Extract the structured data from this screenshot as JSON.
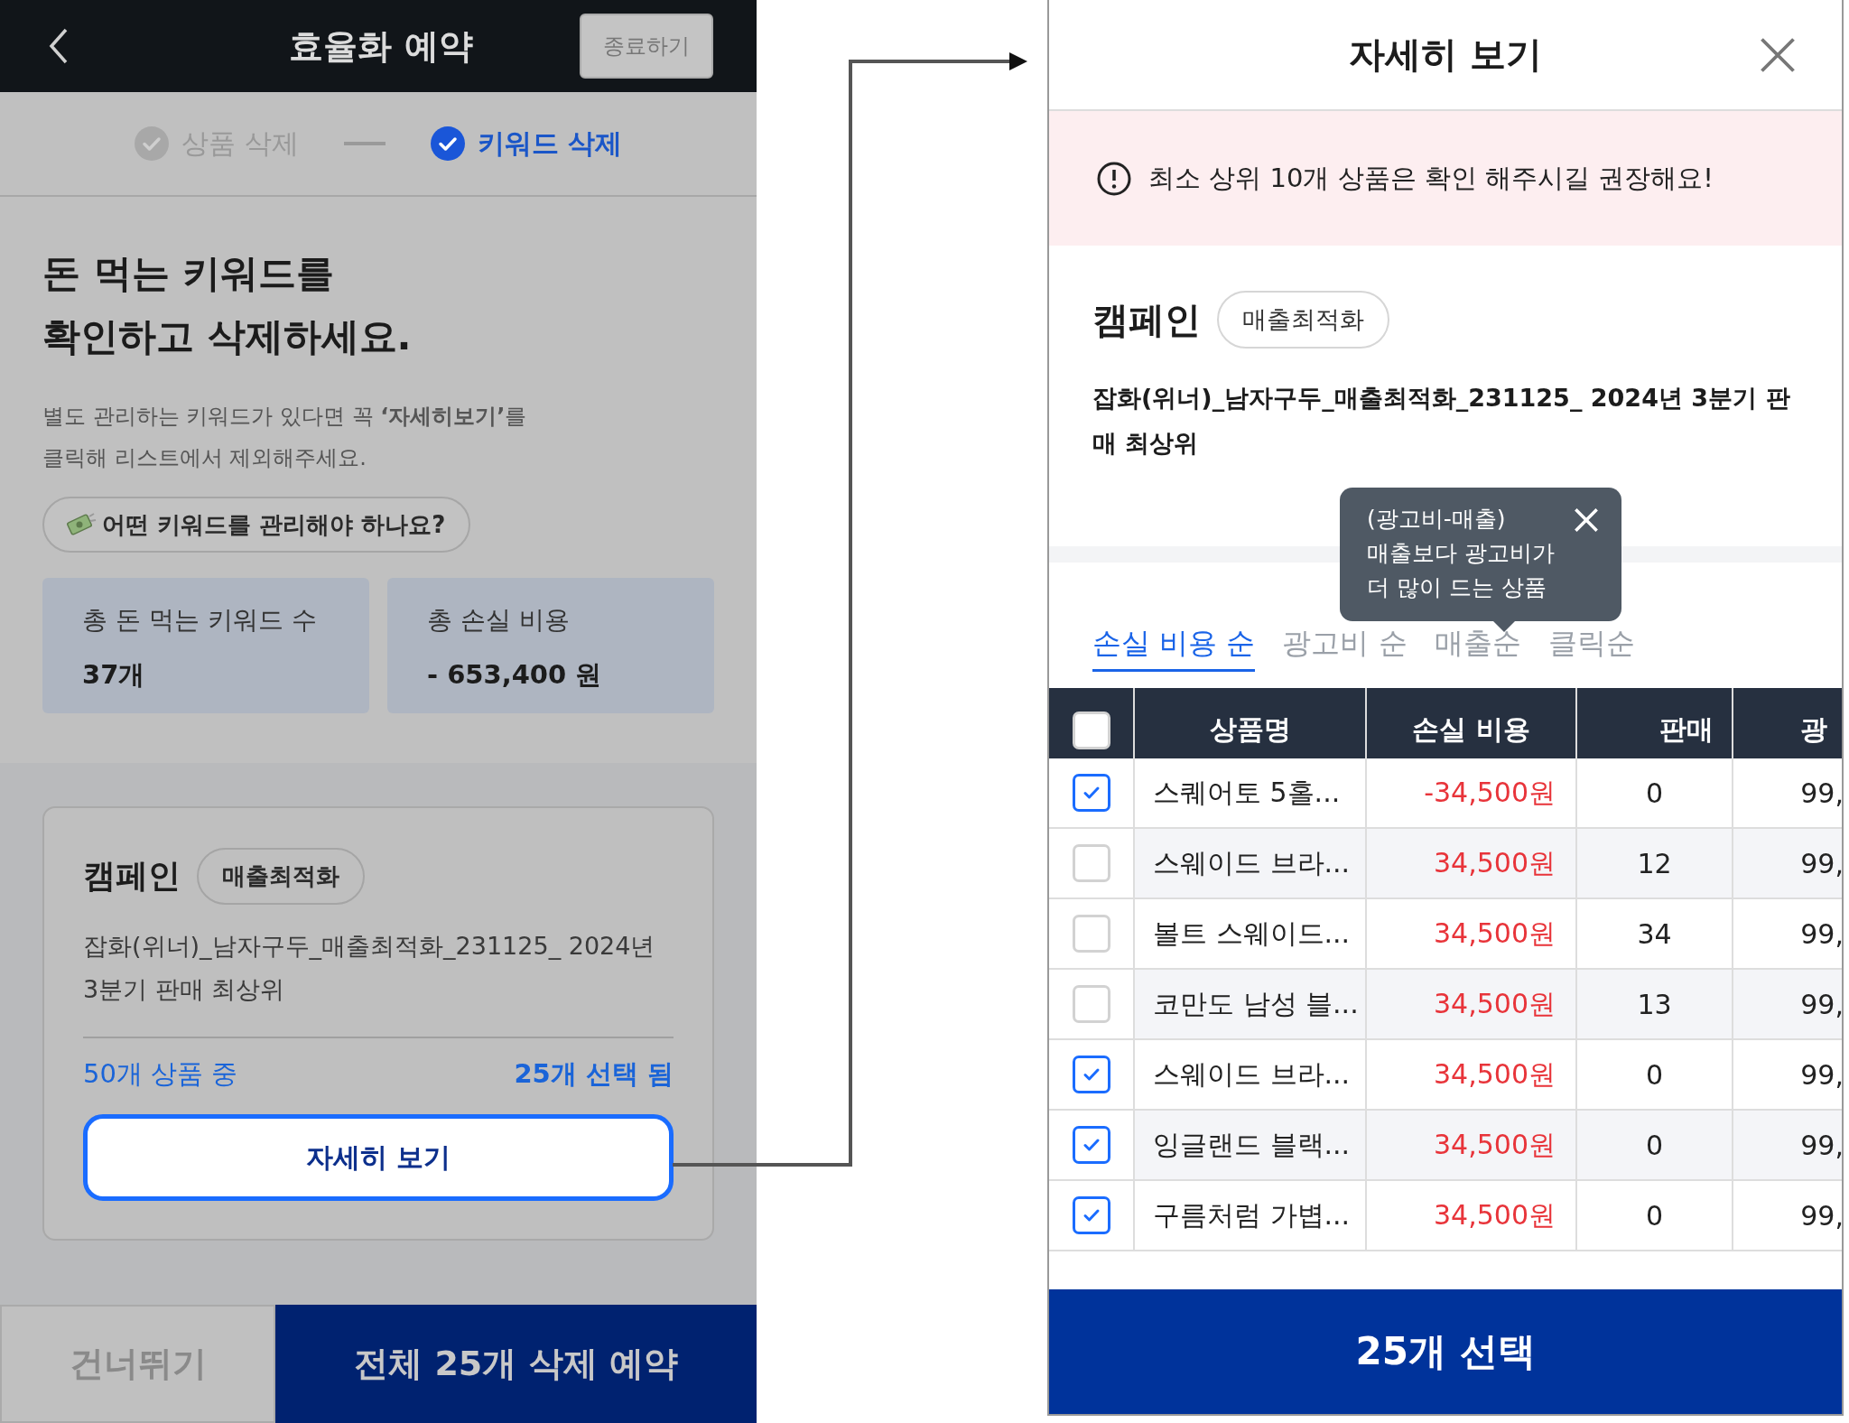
{
  "left_screen": {
    "header": {
      "title": "효율화 예약",
      "end_button": "종료하기"
    },
    "steps": [
      {
        "label": "상품 삭제",
        "active": false
      },
      {
        "label": "키워드 삭제",
        "active": true
      }
    ],
    "heading": [
      "돈 먹는 키워드를",
      "확인하고 삭제하세요."
    ],
    "description": [
      "별도 관리하는 키워드가 있다면 꼭 **‘자세히보기’**를",
      "클릭해 리스트에서 제외해주세요."
    ],
    "help_button": "어떤 키워드를 관리해야 하나요?",
    "stats": [
      {
        "label": "총 돈 먹는 키워드 수",
        "value": "37개"
      },
      {
        "label": "총 손실 비용",
        "value": "- 653,400 원"
      }
    ],
    "campaign": {
      "label": "캠페인",
      "tag": "매출최적화",
      "name": "잡화(위너)_남자구두_매출최적화_231125_ 2024년 3분기 판매 최상위",
      "total": "50개 상품 중",
      "selected": "25개 선택 됨",
      "detail_button": "자세히 보기"
    },
    "footer": {
      "skip_button": "건너뛰기",
      "confirm_button": "전체 25개 삭제 예약"
    }
  },
  "detail_panel": {
    "title": "자세히 보기",
    "alert": "최소 상위 10개 상품은 확인 해주시길 권장해요!",
    "campaign": {
      "label": "캠페인",
      "tag": "매출최적화",
      "name": "잡화(위너)_남자구두_매출최적화_231125_ 2024년 3분기 판매 최상위"
    },
    "tooltip": [
      "(광고비-매출)",
      "매출보다 광고비가",
      "더 많이 드는 상품"
    ],
    "sort_tabs": [
      {
        "label": "손실 비용 순",
        "selected": true
      },
      {
        "label": "광고비 순",
        "selected": false
      },
      {
        "label": "매출순",
        "selected": false
      },
      {
        "label": "클릭순",
        "selected": false
      }
    ],
    "table": {
      "select_all": {
        "checked": false
      },
      "columns": [
        "상품명",
        "손실 비용",
        "판매",
        "광"
      ],
      "rows": [
        {
          "checked": true,
          "name": "스퀘어토 5홀...",
          "loss": "-34,500원",
          "sales": "0",
          "column_5": "99,"
        },
        {
          "checked": false,
          "name": "스웨이드 브라...",
          "loss": "34,500원",
          "sales": "12",
          "column_5": "99,"
        },
        {
          "checked": false,
          "name": "볼트 스웨이드...",
          "loss": "34,500원",
          "sales": "34",
          "column_5": "99,"
        },
        {
          "checked": false,
          "name": "코만도 남성 블...",
          "loss": "34,500원",
          "sales": "13",
          "column_5": "99,"
        },
        {
          "checked": true,
          "name": "스웨이드 브라...",
          "loss": "34,500원",
          "sales": "0",
          "column_5": "99,"
        },
        {
          "checked": true,
          "name": "잉글랜드 블랙...",
          "loss": "34,500원",
          "sales": "0",
          "column_5": "99,"
        },
        {
          "checked": true,
          "name": "구름처럼 가볍...",
          "loss": "34,500원",
          "sales": "0",
          "column_5": "99,"
        }
      ]
    },
    "select_button": "25개 선택"
  }
}
